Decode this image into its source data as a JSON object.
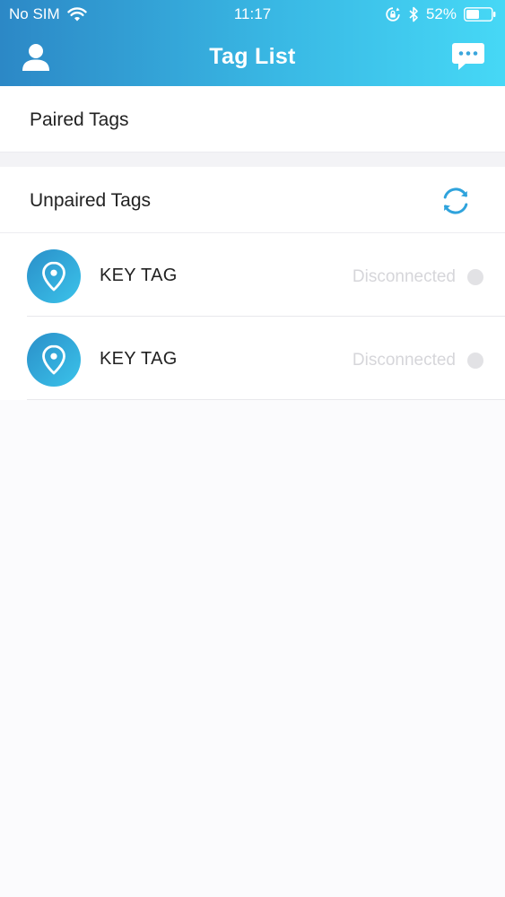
{
  "status_bar": {
    "carrier": "No SIM",
    "time": "11:17",
    "battery_percent": "52%",
    "battery_level": 0.52
  },
  "nav": {
    "title": "Tag List",
    "left_icon": "user-icon",
    "right_icon": "message-icon"
  },
  "sections": {
    "paired": {
      "label": "Paired Tags"
    },
    "unpaired": {
      "label": "Unpaired Tags",
      "action_icon": "refresh-icon"
    }
  },
  "tags": [
    {
      "name": "KEY TAG",
      "status": "Disconnected",
      "icon": "location-pin-icon"
    },
    {
      "name": "KEY TAG",
      "status": "Disconnected",
      "icon": "location-pin-icon"
    }
  ],
  "colors": {
    "header_gradient_start": "#2c88c6",
    "header_gradient_end": "#46d8f6",
    "accent": "#2fa3dc",
    "status_text": "#d6d6da"
  }
}
